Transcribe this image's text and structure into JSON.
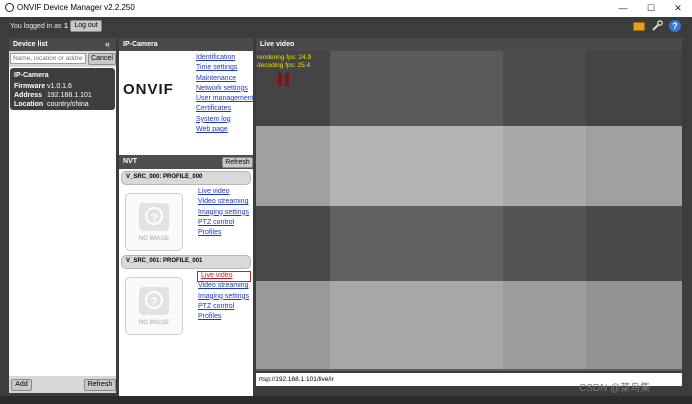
{
  "window": {
    "title": "ONVIF Device Manager v2.2.250",
    "minimize_glyph": "—",
    "maximize_glyph": "☐",
    "close_glyph": "✕"
  },
  "userbar": {
    "logged_text": "You logged in as",
    "user": "1",
    "logout_label": "Log out"
  },
  "device_list": {
    "title": "Device list",
    "collapse_glyph": "«",
    "search_placeholder": "Name, location or address",
    "cancel_label": "Cancel",
    "devices": [
      {
        "name": "IP-Camera",
        "firmware_label": "Firmware",
        "firmware": "v1.0.1.6",
        "address_label": "Address",
        "address": "192.168.1.101",
        "location_label": "Location",
        "location": "country/china"
      }
    ],
    "add_label": "Add",
    "refresh_label": "Refresh"
  },
  "ip_camera": {
    "title": "IP-Camera",
    "logo_text": "ONVIF",
    "links": [
      "Identification",
      "Time settings",
      "Maintenance",
      "Network settings",
      "User management",
      "Certificates",
      "System log",
      "Web page"
    ]
  },
  "nvt": {
    "title": "NVT",
    "refresh_label": "Refresh",
    "no_image_label": "NO IMAGE",
    "profiles": [
      {
        "name": "V_SRC_000: PROFILE_000",
        "links": [
          "Live video",
          "Video streaming",
          "Imaging settings",
          "PTZ control",
          "Profiles"
        ]
      },
      {
        "name": "V_SRC_001: PROFILE_001",
        "links": [
          "Live video",
          "Video streaming",
          "Imaging settings",
          "PTZ control",
          "Profiles"
        ]
      }
    ]
  },
  "live_video": {
    "title": "Live video",
    "rendering_fps": "rendering fps: 24.9",
    "decoding_fps": "decoding fps: 25.4",
    "url": "rtsp://192.168.1.101/live/ir",
    "watermark": "CSDN @菜鸟集",
    "colors": {
      "dark": "#4b4b4b",
      "darker": "#444444",
      "mid": "#7e7e7e",
      "light": "#a7a7a7",
      "lighter": "#b4b4b4",
      "pause": "#8b0f0f",
      "fps_text": "#e8e000"
    }
  },
  "colors": {
    "app_bg": "#3c3c3c",
    "link": "#1f38c8",
    "selected_device_bg": "#3e3e3e"
  }
}
